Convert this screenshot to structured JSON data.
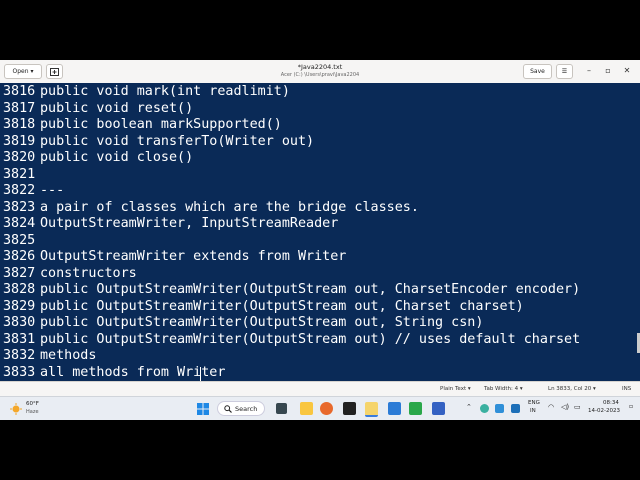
{
  "header": {
    "open_label": "Open",
    "open_chevron": "▾",
    "new_tab_icon": "new-tab-icon",
    "title": "*Java2204.txt",
    "subtitle": "Acer (C:) \\Users\\pravi\\Java2204",
    "save_label": "Save",
    "menu_glyph": "☰",
    "minimize_glyph": "–",
    "maximize_glyph": "▫",
    "close_glyph": "✕"
  },
  "editor": {
    "lines": [
      {
        "num": "3816",
        "text": "public void mark(int readlimit)"
      },
      {
        "num": "3817",
        "text": "public void reset()"
      },
      {
        "num": "3818",
        "text": "public boolean markSupported()"
      },
      {
        "num": "3819",
        "text": "public void transferTo(Writer out)"
      },
      {
        "num": "3820",
        "text": "public void close()"
      },
      {
        "num": "3821",
        "text": ""
      },
      {
        "num": "3822",
        "text": "---"
      },
      {
        "num": "3823",
        "text": "a pair of classes which are the bridge classes."
      },
      {
        "num": "3824",
        "text": "OutputStreamWriter, InputStreamReader"
      },
      {
        "num": "3825",
        "text": ""
      },
      {
        "num": "3826",
        "text": "OutputStreamWriter extends from Writer"
      },
      {
        "num": "3827",
        "text": "constructors"
      },
      {
        "num": "3828",
        "text": "public OutputStreamWriter(OutputStream out, CharsetEncoder encoder)"
      },
      {
        "num": "3829",
        "text": "public OutputStreamWriter(OutputStream out, Charset charset)"
      },
      {
        "num": "3830",
        "text": "public OutputStreamWriter(OutputStream out, String csn)"
      },
      {
        "num": "3831",
        "text": "public OutputStreamWriter(OutputStream out) // uses default charset"
      },
      {
        "num": "3832",
        "text": "methods"
      },
      {
        "num": "3833",
        "text": "all methods from Writer"
      }
    ]
  },
  "status": {
    "syntax": "Plain Text ▾",
    "tab_width": "Tab Width: 4 ▾",
    "position": "Ln 3833, Col 20 ▾",
    "mode": "INS"
  },
  "taskbar": {
    "temp": "60°F",
    "weather": "Haze",
    "search_label": "Search",
    "lang_top": "ENG",
    "lang_bottom": "IN",
    "time": "08:34",
    "date": "14-02-2023"
  }
}
